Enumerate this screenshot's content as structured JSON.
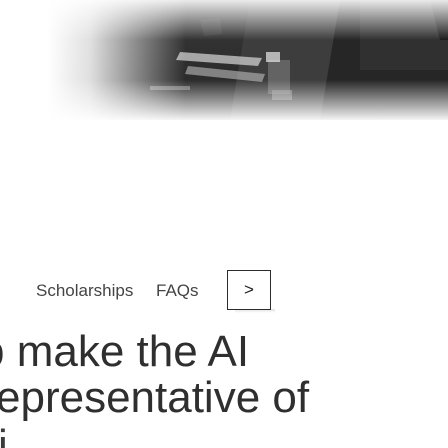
{
  "hero": {
    "image": "photo-banner",
    "colors": {
      "dark": "#2c2c2c",
      "light": "#ffffff"
    }
  },
  "nav": {
    "items": [
      {
        "label": "Scholarships"
      },
      {
        "label": "FAQs"
      }
    ],
    "next_button": {
      "icon": "chevron-right-icon",
      "glyph": ">"
    }
  },
  "headline": {
    "line1": "p make the AI",
    "line2": "epresentative of",
    "line3": "i"
  },
  "colors": {
    "text": "#2f2f2f",
    "nav_text": "#444444",
    "border": "#2b2b2b"
  }
}
